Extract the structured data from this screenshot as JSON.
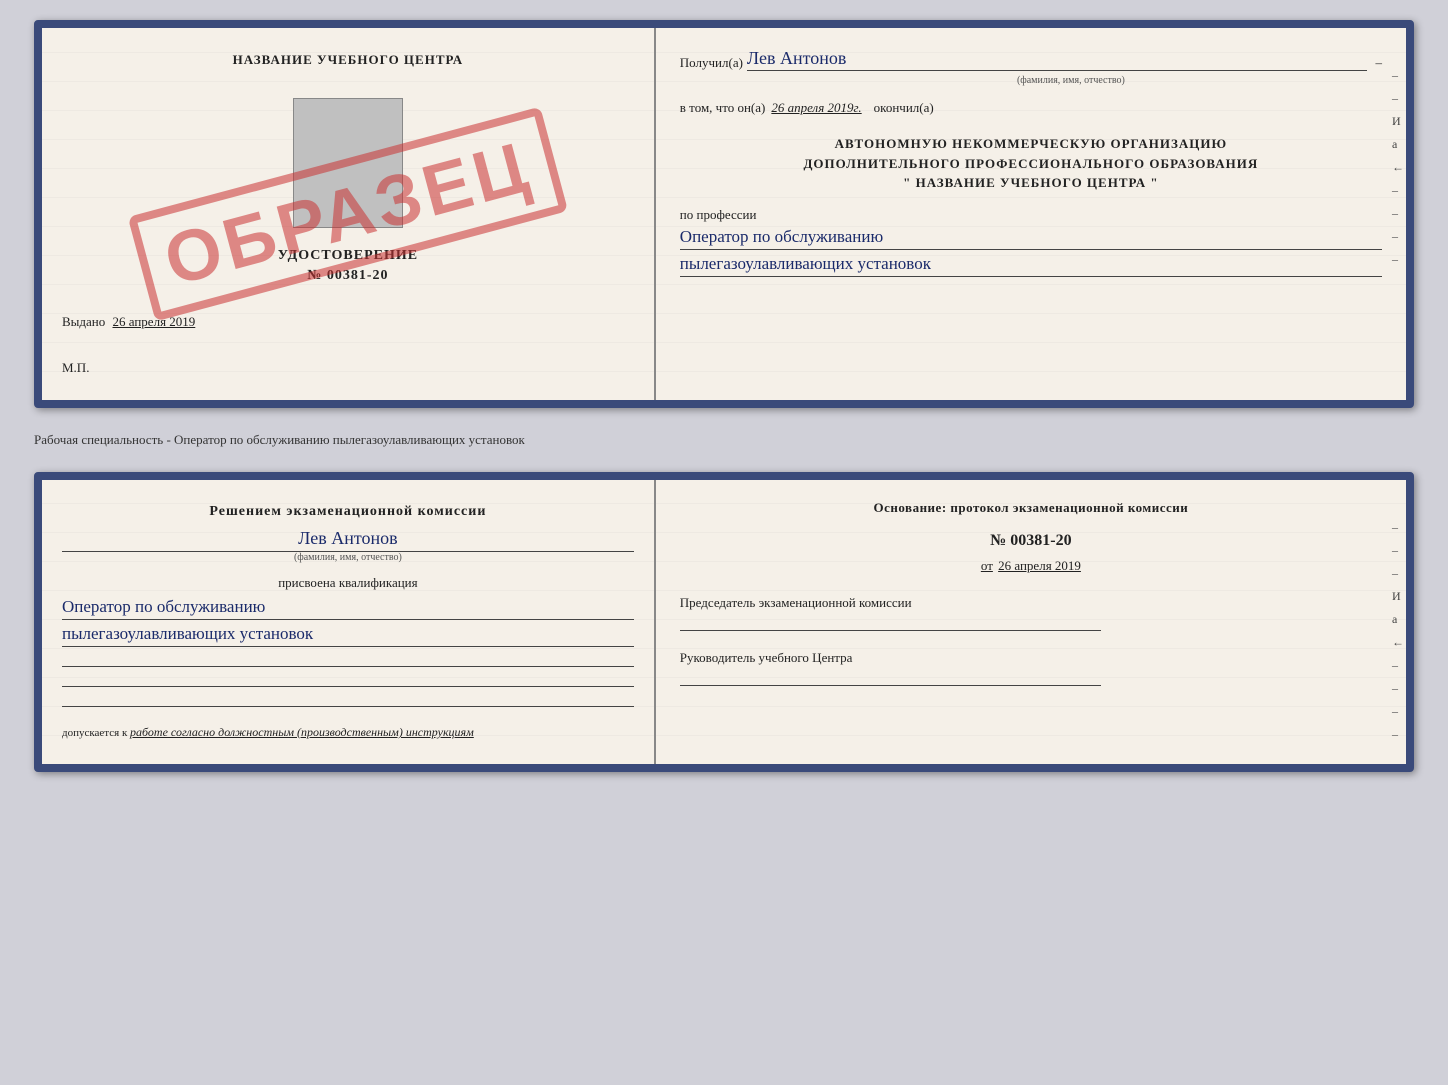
{
  "top_doc": {
    "left": {
      "center_title": "НАЗВАНИЕ УЧЕБНОГО ЦЕНТРА",
      "udostoverenie_title": "УДОСТОВЕРЕНИЕ",
      "udostoverenie_num": "№ 00381-20",
      "stamp_text": "ОБРАЗЕЦ",
      "vydano_label": "Выдано",
      "vydano_date": "26 апреля 2019",
      "mp_label": "М.П."
    },
    "right": {
      "poluchil_label": "Получил(а)",
      "poluchil_name": "Лев Антонов",
      "fio_hint": "(фамилия, имя, отчество)",
      "vtom_label": "в том, что он(а)",
      "vtom_date": "26 апреля 2019г.",
      "okonchil_label": "окончил(а)",
      "org_line1": "АВТОНОМНУЮ НЕКОММЕРЧЕСКУЮ ОРГАНИЗАЦИЮ",
      "org_line2": "ДОПОЛНИТЕЛЬНОГО ПРОФЕССИОНАЛЬНОГО ОБРАЗОВАНИЯ",
      "org_line3": "\" НАЗВАНИЕ УЧЕБНОГО ЦЕНТРА \"",
      "po_professii": "по профессии",
      "prof_line1": "Оператор по обслуживанию",
      "prof_line2": "пылегазоулавливающих установок",
      "side_marks": [
        "–",
        "–",
        "–",
        "И",
        "а",
        "←",
        "–",
        "–",
        "–",
        "–"
      ]
    }
  },
  "separator": {
    "text": "Рабочая специальность - Оператор по обслуживанию пылегазоулавливающих установок"
  },
  "bottom_doc": {
    "left": {
      "resheniem_label": "Решением экзаменационной комиссии",
      "name": "Лев Антонов",
      "fio_hint": "(фамилия, имя, отчество)",
      "prisvoena_label": "присвоена квалификация",
      "kval_line1": "Оператор по обслуживанию",
      "kval_line2": "пылегазоулавливающих установок",
      "empty_lines": [
        "",
        "",
        ""
      ],
      "dopuskaetsya_label": "допускается к",
      "dopuskaetsya_text": "работе согласно должностным (производственным) инструкциям"
    },
    "right": {
      "osnov_label": "Основание: протокол экзаменационной комиссии",
      "protocol_num": "№  00381-20",
      "ot_label": "от",
      "ot_date": "26 апреля 2019",
      "predsedatel_label": "Председатель экзаменационной комиссии",
      "rukovoditel_label": "Руководитель учебного Центра",
      "side_marks": [
        "–",
        "–",
        "–",
        "И",
        "а",
        "←",
        "–",
        "–",
        "–",
        "–"
      ]
    }
  }
}
